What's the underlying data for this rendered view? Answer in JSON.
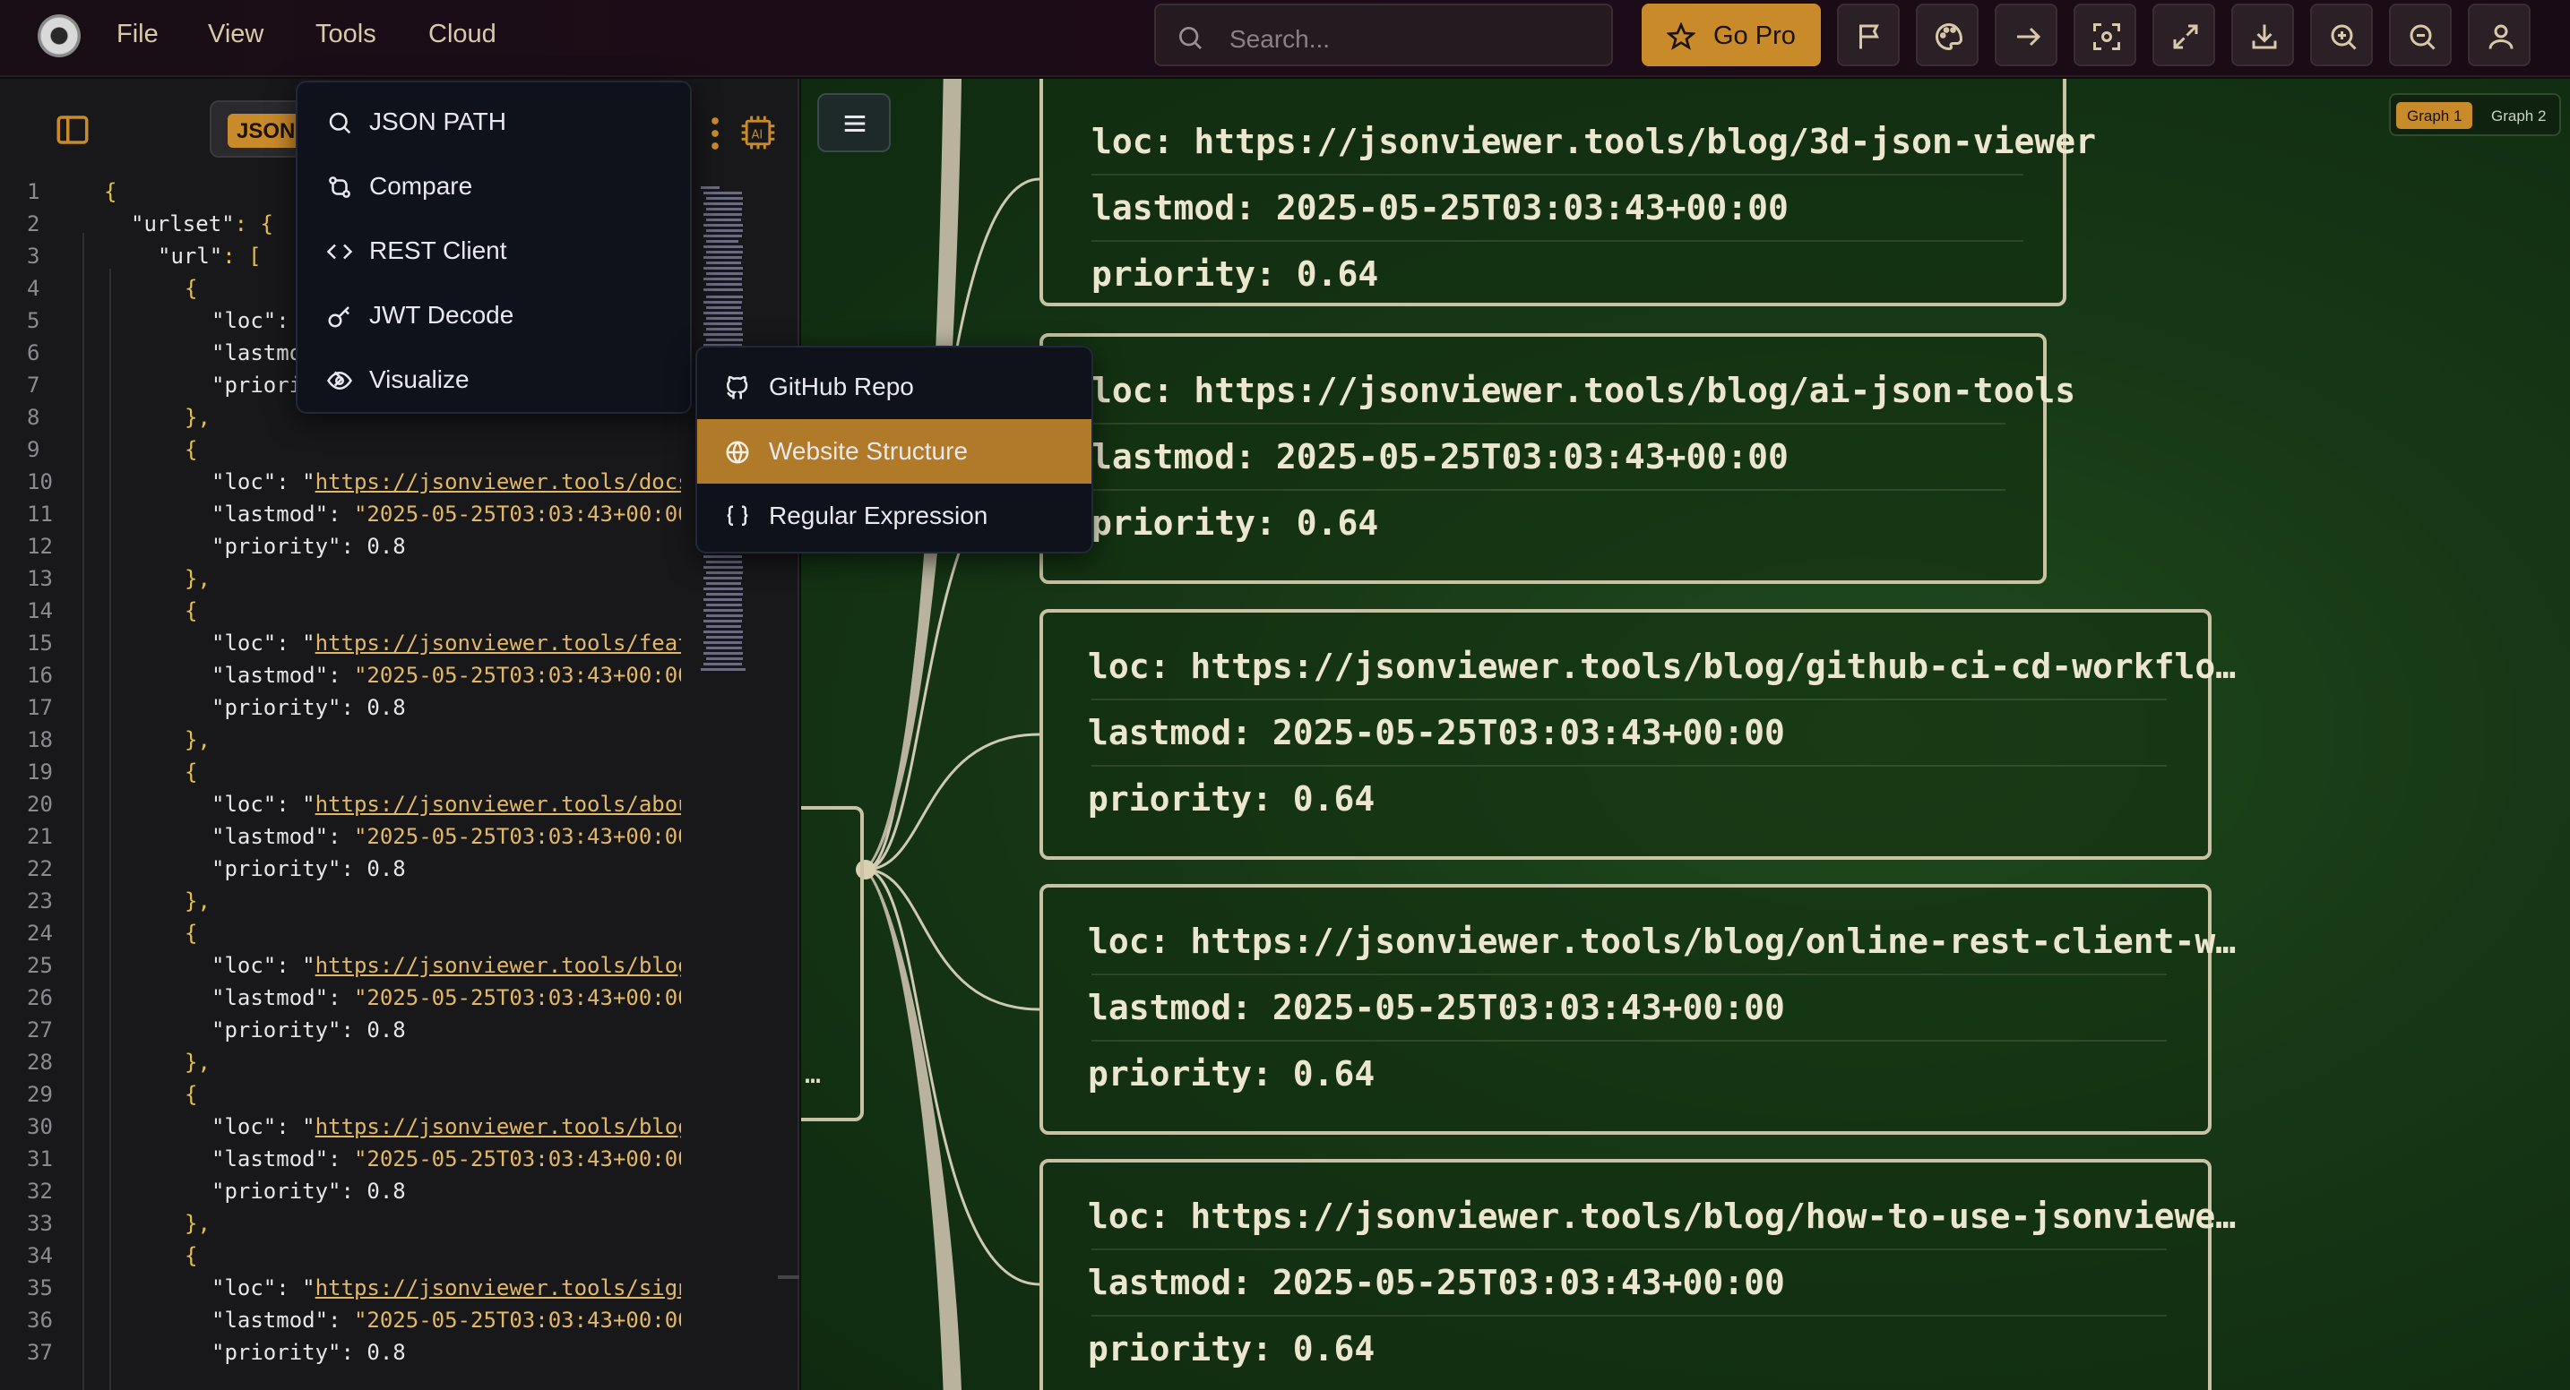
{
  "menubar": {
    "file": "File",
    "view": "View",
    "tools": "Tools",
    "cloud": "Cloud"
  },
  "search": {
    "placeholder": "Search..."
  },
  "go_pro_label": "Go Pro",
  "editor": {
    "format_chip": "JSON",
    "lines": [
      {
        "n": "1"
      },
      {
        "n": "2"
      },
      {
        "n": "3"
      },
      {
        "n": "4"
      },
      {
        "n": "5"
      },
      {
        "n": "6"
      },
      {
        "n": "7"
      },
      {
        "n": "8"
      },
      {
        "n": "9"
      },
      {
        "n": "10"
      },
      {
        "n": "11"
      },
      {
        "n": "12"
      },
      {
        "n": "13"
      },
      {
        "n": "14"
      },
      {
        "n": "15"
      },
      {
        "n": "16"
      },
      {
        "n": "17"
      },
      {
        "n": "18"
      },
      {
        "n": "19"
      },
      {
        "n": "20"
      },
      {
        "n": "21"
      },
      {
        "n": "22"
      },
      {
        "n": "23"
      },
      {
        "n": "24"
      },
      {
        "n": "25"
      },
      {
        "n": "26"
      },
      {
        "n": "27"
      },
      {
        "n": "28"
      },
      {
        "n": "29"
      },
      {
        "n": "30"
      },
      {
        "n": "31"
      },
      {
        "n": "32"
      },
      {
        "n": "33"
      },
      {
        "n": "34"
      },
      {
        "n": "35"
      },
      {
        "n": "36"
      },
      {
        "n": "37"
      }
    ],
    "code": {
      "l1": "{",
      "l2_key": "\"urlset\"",
      "l2_rest": ": {",
      "l3_key": "\"url\"",
      "l3_rest": ": [",
      "l4": "{",
      "l5": "\"loc\":",
      "l6": "\"lastmo",
      "l7": "\"priori",
      "l8": "},",
      "l9": "{",
      "l10_key": "\"loc\"",
      "l10_val": "\"https://jsonviewer.tools/docs",
      "l11_key": "\"lastmod\"",
      "l11_val": "\"2025-05-25T03:03:43+00:00",
      "l12_key": "\"priority\"",
      "l12_val": "0.8",
      "l13": "},",
      "l14": "{",
      "l15_key": "\"loc\"",
      "l15_val": "\"https://jsonviewer.tools/feat",
      "l16_key": "\"lastmod\"",
      "l16_val": "\"2025-05-25T03:03:43+00:00",
      "l17_key": "\"priority\"",
      "l17_val": "0.8",
      "l18": "},",
      "l19": "{",
      "l20_key": "\"loc\"",
      "l20_val": "\"https://jsonviewer.tools/abou",
      "l21_key": "\"lastmod\"",
      "l21_val": "\"2025-05-25T03:03:43+00:00",
      "l22_key": "\"priority\"",
      "l22_val": "0.8",
      "l23": "},",
      "l24": "{",
      "l25_key": "\"loc\"",
      "l25_val": "\"https://jsonviewer.tools/blog",
      "l26_key": "\"lastmod\"",
      "l26_val": "\"2025-05-25T03:03:43+00:00",
      "l27_key": "\"priority\"",
      "l27_val": "0.8",
      "l28": "},",
      "l29": "{",
      "l30_key": "\"loc\"",
      "l30_val": "\"https://jsonviewer.tools/blog",
      "l31_key": "\"lastmod\"",
      "l31_val": "\"2025-05-25T03:03:43+00:00",
      "l32_key": "\"priority\"",
      "l32_val": "0.8",
      "l33": "},",
      "l34": "{",
      "l35_key": "\"loc\"",
      "l35_val": "\"https://jsonviewer.tools/sign",
      "l36_key": "\"lastmod\"",
      "l36_val": "\"2025-05-25T03:03:43+00:00",
      "l37_key": "\"priority\"",
      "l37_val": "0.8"
    }
  },
  "tools_menu": {
    "items": [
      {
        "label": "JSON PATH",
        "icon": "search-icon"
      },
      {
        "label": "Compare",
        "icon": "git-compare-icon"
      },
      {
        "label": "REST Client",
        "icon": "code-brackets-icon"
      },
      {
        "label": "JWT Decode",
        "icon": "key-icon"
      },
      {
        "label": "Visualize",
        "icon": "eye-icon"
      }
    ]
  },
  "visualize_submenu": {
    "items": [
      {
        "label": "GitHub Repo",
        "icon": "github-icon"
      },
      {
        "label": "Website Structure",
        "icon": "globe-icon",
        "selected": true
      },
      {
        "label": "Regular Expression",
        "icon": "braces-icon"
      }
    ]
  },
  "graph": {
    "tabs": [
      "Graph 1",
      "Graph 2"
    ],
    "parent_ellipsis": "…",
    "nodes": [
      {
        "loc": "loc: https://jsonviewer.tools/blog/3d-json-viewer",
        "lastmod": "lastmod: 2025-05-25T03:03:43+00:00",
        "priority": "priority: 0.64"
      },
      {
        "loc": "loc: https://jsonviewer.tools/blog/ai-json-tools",
        "lastmod": "lastmod: 2025-05-25T03:03:43+00:00",
        "priority": "priority: 0.64"
      },
      {
        "loc": "loc: https://jsonviewer.tools/blog/github-ci-cd-workflo…",
        "lastmod": "lastmod: 2025-05-25T03:03:43+00:00",
        "priority": "priority: 0.64"
      },
      {
        "loc": "loc: https://jsonviewer.tools/blog/online-rest-client-w…",
        "lastmod": "lastmod: 2025-05-25T03:03:43+00:00",
        "priority": "priority: 0.64"
      },
      {
        "loc": "loc: https://jsonviewer.tools/blog/how-to-use-jsonviewe…",
        "lastmod": "lastmod: 2025-05-25T03:03:43+00:00",
        "priority": "priority: 0.64"
      }
    ]
  },
  "colors": {
    "accent": "#c98a2a",
    "graph_bg": "#173816",
    "node_border": "#c9c2a4"
  }
}
